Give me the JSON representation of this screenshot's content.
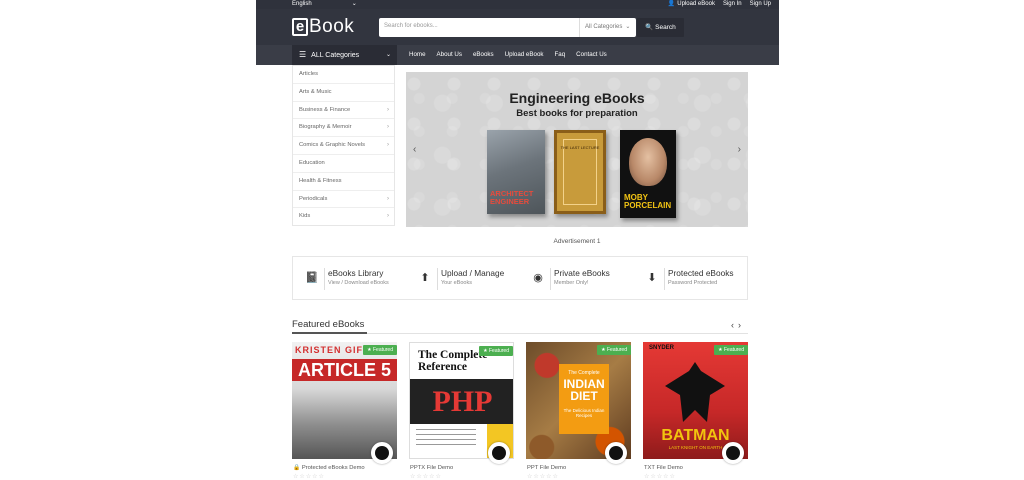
{
  "topbar": {
    "language": "English",
    "upload": "Upload eBook",
    "signin": "Sign In",
    "signup": "Sign Up"
  },
  "header": {
    "logo_letter": "e",
    "logo_text": "Book",
    "search_placeholder": "Search for ebooks...",
    "category_select": "All Categories",
    "search_button": "Search"
  },
  "nav": {
    "all_categories": "ALL Categories",
    "links": [
      "Home",
      "About Us",
      "eBooks",
      "Upload eBook",
      "Faq",
      "Contact Us"
    ]
  },
  "sidebar": {
    "items": [
      {
        "label": "Articles",
        "has_sub": false
      },
      {
        "label": "Arts & Music",
        "has_sub": false
      },
      {
        "label": "Business & Finance",
        "has_sub": true
      },
      {
        "label": "Biography & Memoir",
        "has_sub": true
      },
      {
        "label": "Comics & Graphic Novels",
        "has_sub": true
      },
      {
        "label": "Education",
        "has_sub": false
      },
      {
        "label": "Health & Fitness",
        "has_sub": false
      },
      {
        "label": "Periodicals",
        "has_sub": true
      },
      {
        "label": "Kids",
        "has_sub": true
      }
    ]
  },
  "banner": {
    "title": "Engineering eBooks",
    "subtitle": "Best books for preparation",
    "book1_text": "ARCHITECT ENGINEER",
    "book2_text": "THE LAST LECTURE",
    "book3_text": "MOBY PORCELAIN",
    "prev": "‹",
    "next": "›"
  },
  "advertisement": "Advertisement 1",
  "features": [
    {
      "icon": "book-icon",
      "glyph": "📓",
      "title": "eBooks Library",
      "subtitle": "View / Download eBooks"
    },
    {
      "icon": "upload-icon",
      "glyph": "⬆",
      "title": "Upload / Manage",
      "subtitle": "Your eBooks"
    },
    {
      "icon": "user-icon",
      "glyph": "◉",
      "title": "Private eBooks",
      "subtitle": "Member Only!"
    },
    {
      "icon": "download-icon",
      "glyph": "⬇",
      "title": "Protected eBooks",
      "subtitle": "Password Protected"
    }
  ],
  "featured": {
    "heading": "Featured eBooks",
    "badge": "★ Featured",
    "stars": "☆☆☆☆☆",
    "cards": [
      {
        "name": "🔒 Protected eBooks Demo",
        "cover_top": "KRISTEN GIF",
        "cover_title": "ARTICLE 5"
      },
      {
        "name": "PPTX File Demo",
        "cover_top": "The Complete Reference",
        "cover_title": "PHP"
      },
      {
        "name": "PPT File Demo",
        "cover_top": "The Complete",
        "cover_title": "INDIAN DIET",
        "cover_sub": "The Delicious Indian Recipes"
      },
      {
        "name": "TXT File Demo",
        "cover_top": "SNYDER",
        "cover_title": "BATMAN",
        "cover_sub": "LAST KNIGHT ON EARTH"
      }
    ]
  }
}
